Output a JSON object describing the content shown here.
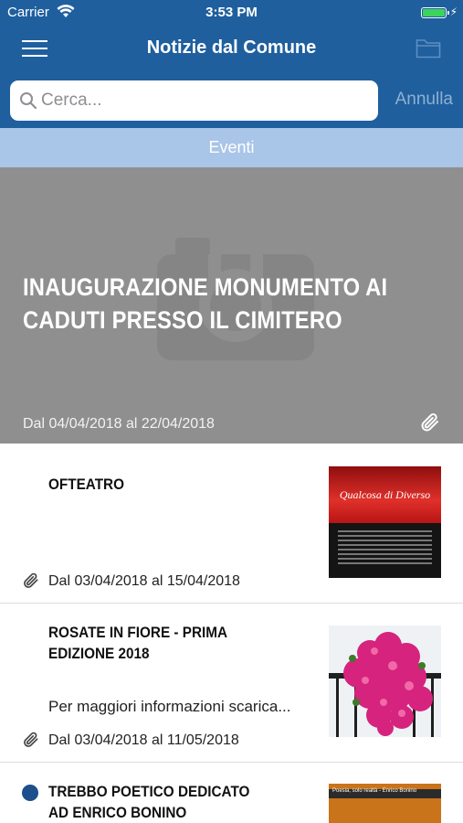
{
  "status_bar": {
    "carrier": "Carrier",
    "time": "3:53 PM",
    "battery_level": 1.0,
    "battery_color": "#3dd45d",
    "charging_icon": "bolt-icon"
  },
  "nav": {
    "title": "Notizie dal Comune",
    "menu_icon": "hamburger-menu-icon",
    "folder_icon": "folder-icon"
  },
  "search": {
    "placeholder": "Cerca...",
    "value": "",
    "cancel_label": "Annulla"
  },
  "section": {
    "label": "Eventi"
  },
  "featured": {
    "title": "INAUGURAZIONE MONUMENTO AI CADUTI PRESSO IL CIMITERO",
    "dates": "Dal 04/04/2018 al 22/04/2018",
    "has_attachment": true
  },
  "items": [
    {
      "title": "OFTEATRO",
      "summary": "",
      "dates": "Dal 03/04/2018 al 15/04/2018",
      "has_attachment": true,
      "thumbnail": "poster-qualcosa-di-diverso",
      "thumbnail_text": "Qualcosa di Diverso"
    },
    {
      "title": "ROSATE IN FIORE - PRIMA EDIZIONE 2018",
      "summary": "Per maggiori informazioni scarica...",
      "dates": "Dal 03/04/2018 al 11/05/2018",
      "has_attachment": true,
      "thumbnail": "pink-flowers-photo"
    },
    {
      "title": "TREBBO POETICO DEDICATO AD ENRICO BONINO",
      "summary": "",
      "dates": "",
      "unread": true,
      "thumbnail": "poster-poesia",
      "thumbnail_text": "Poesia, solo realtà - Enrico Bonino"
    }
  ],
  "colors": {
    "primary": "#1f5f9e",
    "section_header": "#a9c5e8",
    "unread_dot": "#1c4f8c"
  }
}
